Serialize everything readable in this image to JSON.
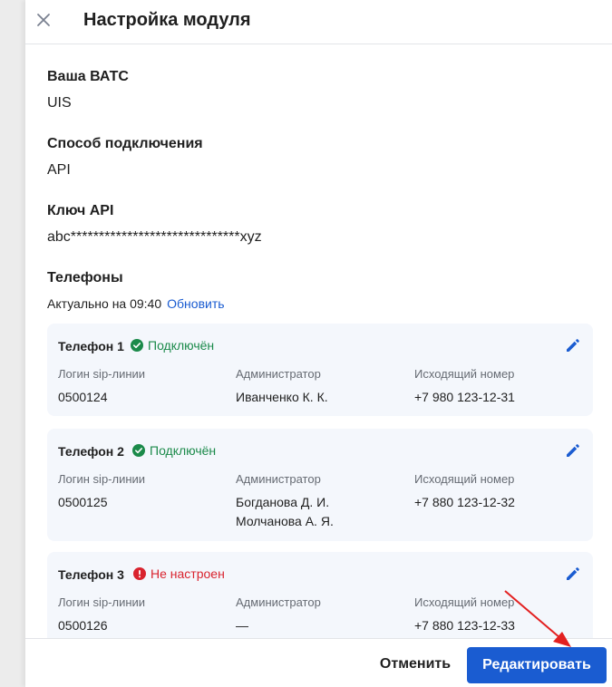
{
  "header": {
    "title": "Настройка модуля",
    "close_icon": "close-icon"
  },
  "fields": {
    "vats_label": "Ваша ВАТС",
    "vats_value": "UIS",
    "conn_label": "Способ подключения",
    "conn_value": "API",
    "key_label": "Ключ API",
    "key_value": "abc******************************xyz",
    "phones_label": "Телефоны",
    "actual_text": "Актуально на 09:40",
    "refresh_label": "Обновить"
  },
  "columns": {
    "login": "Логин sip-линии",
    "admin": "Администратор",
    "outgoing": "Исходящий номер"
  },
  "phones": [
    {
      "title": "Телефон 1",
      "status": "Подключён",
      "login": "0500124",
      "admin_1": "Иванченко К. К.",
      "admin_2": "",
      "number": "+7 980 123-12-31"
    },
    {
      "title": "Телефон 2",
      "status": "Подключён",
      "login": "0500125",
      "admin_1": "Богданова Д. И.",
      "admin_2": "Молчанова А. Я.",
      "number": "+7 880 123-12-32"
    },
    {
      "title": "Телефон 3",
      "status": "Не настроен",
      "login": "0500126",
      "admin_1": "—",
      "admin_2": "",
      "number": "+7 880 123-12-33"
    }
  ],
  "footer": {
    "cancel_label": "Отменить",
    "edit_label": "Редактировать"
  },
  "colors": {
    "accent": "#1a5cd1",
    "ok": "#1b8a4a",
    "error": "#d9232e",
    "arrow": "#e32020"
  }
}
